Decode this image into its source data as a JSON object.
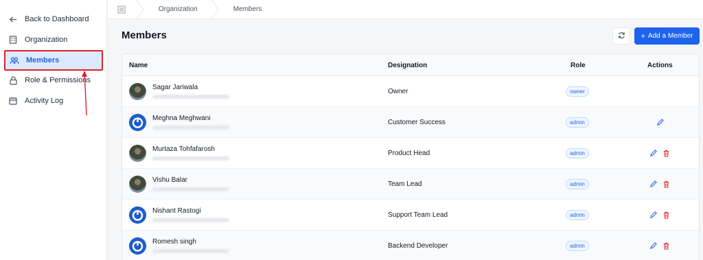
{
  "sidebar": {
    "items": [
      {
        "label": "Back to Dashboard",
        "icon": "arrow-left-icon"
      },
      {
        "label": "Organization",
        "icon": "building-icon"
      },
      {
        "label": "Members",
        "icon": "users-icon",
        "active": true
      },
      {
        "label": "Role & Permissions",
        "icon": "lock-icon"
      },
      {
        "label": "Activity Log",
        "icon": "calendar-icon"
      }
    ]
  },
  "breadcrumb": {
    "home_icon": "home-icon",
    "items": [
      "Organization",
      "Members"
    ]
  },
  "header": {
    "title": "Members",
    "refresh_icon": "refresh-icon",
    "add_button_label": "Add a Member",
    "add_button_icon": "plus-icon"
  },
  "table": {
    "columns": {
      "name": "Name",
      "designation": "Designation",
      "role": "Role",
      "actions": "Actions"
    },
    "rows": [
      {
        "name": "Sagar Jariwala",
        "designation": "Owner",
        "role": "owner",
        "avatar": "photo",
        "can_edit": false,
        "can_delete": false
      },
      {
        "name": "Meghna Meghwani",
        "designation": "Customer Success",
        "role": "admin",
        "avatar": "logo",
        "can_edit": true,
        "can_delete": false
      },
      {
        "name": "Murtaza Tohfafarosh",
        "designation": "Product Head",
        "role": "admin",
        "avatar": "photo",
        "can_edit": true,
        "can_delete": true
      },
      {
        "name": "Vishu Balar",
        "designation": "Team Lead",
        "role": "admin",
        "avatar": "photo",
        "can_edit": true,
        "can_delete": true
      },
      {
        "name": "Nishant Rastogi",
        "designation": "Support Team Lead",
        "role": "admin",
        "avatar": "logo",
        "can_edit": true,
        "can_delete": true
      },
      {
        "name": "Romesh singh",
        "designation": "Backend Developer",
        "role": "admin",
        "avatar": "logo",
        "can_edit": true,
        "can_delete": true
      }
    ]
  },
  "colors": {
    "accent": "#1d63ed",
    "annotation": "#e11d2a",
    "active_bg": "#dbeafe",
    "delete": "#dc2626"
  }
}
